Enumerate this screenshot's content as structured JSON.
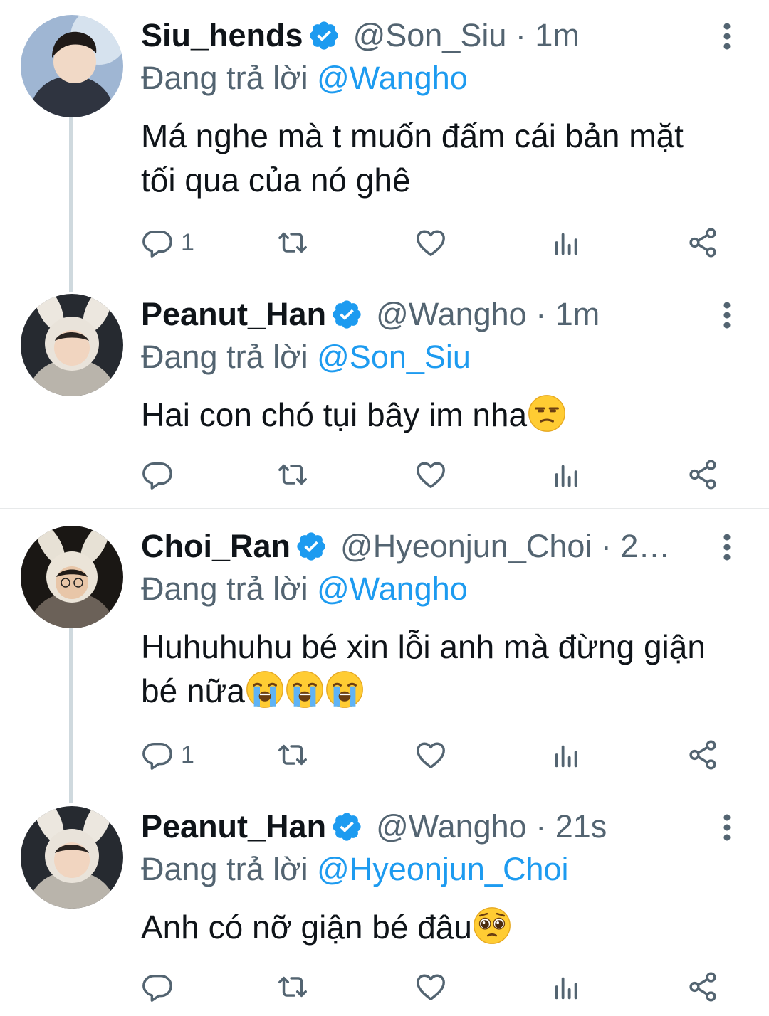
{
  "accent_color": "#1d9bf0",
  "tweets": [
    {
      "name": "Siu_hends",
      "handle": "@Son_Siu",
      "time": "1m",
      "reply_prefix": "Đang trả lời",
      "reply_to": "@Wangho",
      "text": "Má nghe mà t muốn đấm cái bản mặt tối qua của nó ghê",
      "reply_count": "1"
    },
    {
      "name": "Peanut_Han",
      "handle": "@Wangho",
      "time": "1m",
      "reply_prefix": "Đang trả lời",
      "reply_to": "@Son_Siu",
      "text": "Hai con chó tụi bây im nha",
      "reply_count": ""
    },
    {
      "name": "Choi_Ran",
      "handle": "@Hyeonjun_Choi",
      "time": "2…",
      "reply_prefix": "Đang trả lời",
      "reply_to": "@Wangho",
      "text": "Huhuhuhu bé xin lỗi anh mà đừng giận bé nữa",
      "reply_count": "1"
    },
    {
      "name": "Peanut_Han",
      "handle": "@Wangho",
      "time": "21s",
      "reply_prefix": "Đang trả lời",
      "reply_to": "@Hyeonjun_Choi",
      "text": "Anh có nỡ giận bé đâu",
      "reply_count": ""
    }
  ],
  "icons": {
    "reply": "reply-icon",
    "retweet": "retweet-icon",
    "like": "heart-icon",
    "views": "views-icon",
    "share": "share-icon",
    "more": "more-vertical-icon",
    "verified": "verified-badge-icon"
  },
  "emojis": {
    "tweet_2": [
      "unamused-face"
    ],
    "tweet_3": [
      "loudly-crying-face",
      "loudly-crying-face",
      "loudly-crying-face"
    ],
    "tweet_4": [
      "pleading-face"
    ]
  }
}
